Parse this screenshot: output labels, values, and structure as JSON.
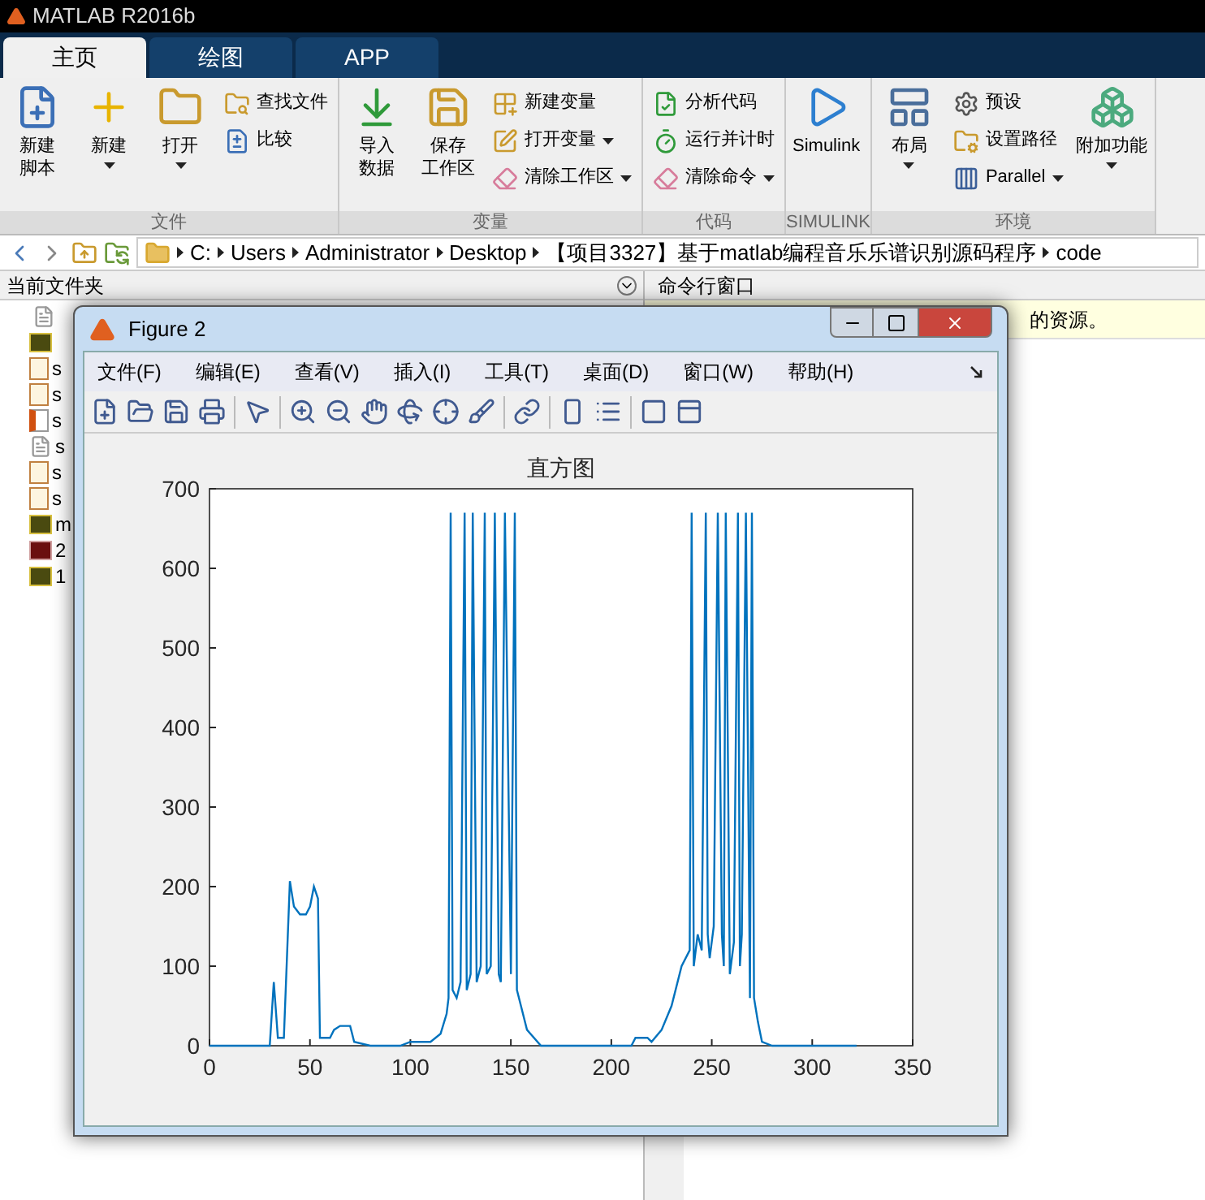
{
  "window": {
    "title": "MATLAB R2016b"
  },
  "tabs": [
    {
      "label": "主页",
      "selected": true
    },
    {
      "label": "绘图",
      "selected": false
    },
    {
      "label": "APP",
      "selected": false
    }
  ],
  "ribbon": {
    "groups": [
      {
        "label": "文件",
        "items": [
          {
            "kind": "large",
            "label": "新建脚本",
            "two_line": true,
            "dropdown": false
          },
          {
            "kind": "large",
            "label": "新建",
            "two_line": false,
            "dropdown": true
          },
          {
            "kind": "large",
            "label": "打开",
            "two_line": false,
            "dropdown": true
          },
          {
            "kind": "small",
            "label": "查找文件",
            "dropdown": false
          },
          {
            "kind": "small",
            "label": "比较",
            "dropdown": false
          }
        ]
      },
      {
        "label": "变量",
        "items": [
          {
            "kind": "large",
            "label": "导入数据",
            "two_line": true,
            "dropdown": false
          },
          {
            "kind": "large",
            "label": "保存工作区",
            "two_line": true,
            "dropdown": false
          },
          {
            "kind": "small",
            "label": "新建变量",
            "dropdown": false
          },
          {
            "kind": "small",
            "label": "打开变量",
            "dropdown": true
          },
          {
            "kind": "small",
            "label": "清除工作区",
            "dropdown": true
          }
        ]
      },
      {
        "label": "代码",
        "items": [
          {
            "kind": "small",
            "label": "分析代码",
            "dropdown": false
          },
          {
            "kind": "small",
            "label": "运行并计时",
            "dropdown": false
          },
          {
            "kind": "small",
            "label": "清除命令",
            "dropdown": true
          }
        ]
      },
      {
        "label": "SIMULINK",
        "items": [
          {
            "kind": "large",
            "label": "Simulink",
            "two_line": false,
            "dropdown": false
          }
        ]
      },
      {
        "label": "环境",
        "items": [
          {
            "kind": "large",
            "label": "布局",
            "two_line": false,
            "dropdown": true
          },
          {
            "kind": "small",
            "label": "预设",
            "dropdown": false
          },
          {
            "kind": "small",
            "label": "设置路径",
            "dropdown": false
          },
          {
            "kind": "small",
            "label": "Parallel",
            "dropdown": true
          },
          {
            "kind": "large",
            "label": "附加功能",
            "two_line": false,
            "dropdown": true
          }
        ]
      }
    ]
  },
  "address_bar": {
    "segments": [
      "C:",
      "Users",
      "Administrator",
      "Desktop",
      "【项目3327】基于matlab编程音乐乐谱识别源码程序",
      "code"
    ]
  },
  "current_folder": {
    "title": "当前文件夹",
    "files": [
      {
        "kind": "blank"
      },
      {
        "kind": "jpg"
      },
      {
        "kind": "fx",
        "name": "s"
      },
      {
        "kind": "fx",
        "name": "s"
      },
      {
        "kind": "mlx",
        "name": "s"
      },
      {
        "kind": "blank",
        "name": "s"
      },
      {
        "kind": "fx",
        "name": "s"
      },
      {
        "kind": "fx",
        "name": "s"
      },
      {
        "kind": "jpg",
        "name": "m"
      },
      {
        "kind": "png",
        "name": "2"
      },
      {
        "kind": "jpg",
        "name": "1"
      }
    ]
  },
  "command_window": {
    "title": "命令行窗口",
    "notice": "的资源。"
  },
  "figure": {
    "title": "Figure 2",
    "menu": [
      "文件(F)",
      "编辑(E)",
      "查看(V)",
      "插入(I)",
      "工具(T)",
      "桌面(D)",
      "窗口(W)",
      "帮助(H)"
    ],
    "chart_data": {
      "type": "line",
      "title": "直方图",
      "xlim": [
        0,
        350
      ],
      "ylim": [
        0,
        700
      ],
      "xticks": [
        0,
        50,
        100,
        150,
        200,
        250,
        300,
        350
      ],
      "yticks": [
        0,
        100,
        200,
        300,
        400,
        500,
        600,
        700
      ],
      "x": [
        0,
        30,
        32,
        34,
        37,
        40,
        42,
        45,
        48,
        50,
        52,
        54,
        55,
        60,
        62,
        65,
        70,
        72,
        80,
        95,
        100,
        110,
        115,
        118,
        119,
        120,
        121,
        123,
        125,
        127,
        128,
        130,
        131,
        133,
        135,
        137,
        138,
        140,
        142,
        144,
        145,
        147,
        150,
        152,
        153,
        155,
        158,
        165,
        210,
        212,
        218,
        220,
        225,
        230,
        235,
        239,
        240,
        241,
        243,
        245,
        247,
        248,
        249,
        251,
        253,
        255,
        256,
        257,
        259,
        261,
        263,
        264,
        265,
        267,
        269,
        270,
        271,
        273,
        275,
        280,
        322
      ],
      "series": [
        {
          "color": "#0072bd",
          "values": [
            0,
            0,
            80,
            10,
            10,
            207,
            175,
            165,
            165,
            175,
            200,
            185,
            10,
            10,
            20,
            25,
            25,
            5,
            0,
            0,
            5,
            5,
            15,
            40,
            60,
            670,
            70,
            60,
            80,
            670,
            70,
            90,
            670,
            80,
            100,
            670,
            90,
            100,
            670,
            90,
            80,
            670,
            90,
            670,
            70,
            50,
            20,
            0,
            0,
            10,
            10,
            5,
            20,
            50,
            100,
            120,
            670,
            100,
            140,
            120,
            670,
            140,
            110,
            150,
            670,
            140,
            100,
            670,
            90,
            130,
            670,
            100,
            140,
            670,
            60,
            670,
            60,
            30,
            5,
            0,
            0
          ]
        }
      ]
    }
  }
}
